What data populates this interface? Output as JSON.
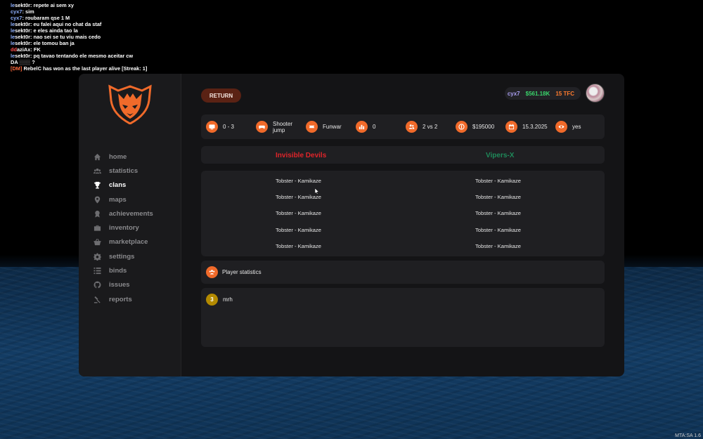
{
  "chat": [
    {
      "prefix": "le",
      "name": "sekt0r",
      "text": ": repete ai sem xy"
    },
    {
      "prefix": "",
      "name": "cyx7",
      "text": ": sim"
    },
    {
      "prefix": "",
      "name": "cyx7",
      "text": ": roubaram qse 1 M"
    },
    {
      "prefix": "le",
      "name": "sekt0r",
      "text": ": eu falei aqui no chat da staf"
    },
    {
      "prefix": "le",
      "name": "sekt0r",
      "text": ": e eles ainda tao la"
    },
    {
      "prefix": "le",
      "name": "sekt0r",
      "text": ": nao sei se tu viu mais cedo"
    },
    {
      "prefix": "le",
      "name": "sekt0r",
      "text": ": ele tomou ban ja"
    },
    {
      "prefix": "dd",
      "name": "aziAx",
      "text": ": FK"
    },
    {
      "prefix": "le",
      "name": "sekt0r",
      "text": ": pq tavao tentando ele mesmo aceitar cw"
    },
    {
      "prefix": "",
      "name": "DA",
      "text": " ?"
    },
    {
      "prefix": "[DM]",
      "name": "RebelC",
      "text": " has won as the last player alive [Streak: 1]"
    }
  ],
  "watermark": "MTA:SA 1.6",
  "sidebar": {
    "items": [
      {
        "label": "home",
        "icon": "home-icon"
      },
      {
        "label": "statistics",
        "icon": "users-icon"
      },
      {
        "label": "clans",
        "icon": "trophy-icon",
        "active": true
      },
      {
        "label": "maps",
        "icon": "map-pin-icon"
      },
      {
        "label": "achievements",
        "icon": "award-icon"
      },
      {
        "label": "inventory",
        "icon": "briefcase-icon"
      },
      {
        "label": "marketplace",
        "icon": "basket-icon"
      },
      {
        "label": "settings",
        "icon": "gear-icon"
      },
      {
        "label": "binds",
        "icon": "list-icon"
      },
      {
        "label": "issues",
        "icon": "github-icon"
      },
      {
        "label": "reports",
        "icon": "report-icon"
      }
    ]
  },
  "header": {
    "return_label": "RETURN",
    "username": "cyx7",
    "money": "$561.18K",
    "tfc": "15 TFC"
  },
  "match": {
    "score": "0 - 3",
    "mode_line1": "Shooter",
    "mode_line2": "jump",
    "type": "Funwar",
    "rounds": "0",
    "format": "2 vs 2",
    "prize": "$195000",
    "date": "15.3.2025",
    "visible": "yes"
  },
  "teams": {
    "a": {
      "name": "Invisible Devils",
      "color": "#e0242a"
    },
    "b": {
      "name": "Vipers-X",
      "color": "#1f8a5a"
    }
  },
  "roster": {
    "a": [
      "Tobster - Kamikaze",
      "Tobster - Kamikaze",
      "Tobster - Kamikaze",
      "Tobster - Kamikaze",
      "Tobster - Kamikaze"
    ],
    "b": [
      "Tobster - Kamikaze",
      "Tobster - Kamikaze",
      "Tobster - Kamikaze",
      "Tobster - Kamikaze",
      "Tobster - Kamikaze"
    ]
  },
  "player_stats": {
    "label": "Player statistics",
    "players": [
      {
        "rank": "3",
        "name": "mrh"
      }
    ]
  },
  "colors": {
    "accent": "#f06a2a",
    "panel": "#141416"
  }
}
